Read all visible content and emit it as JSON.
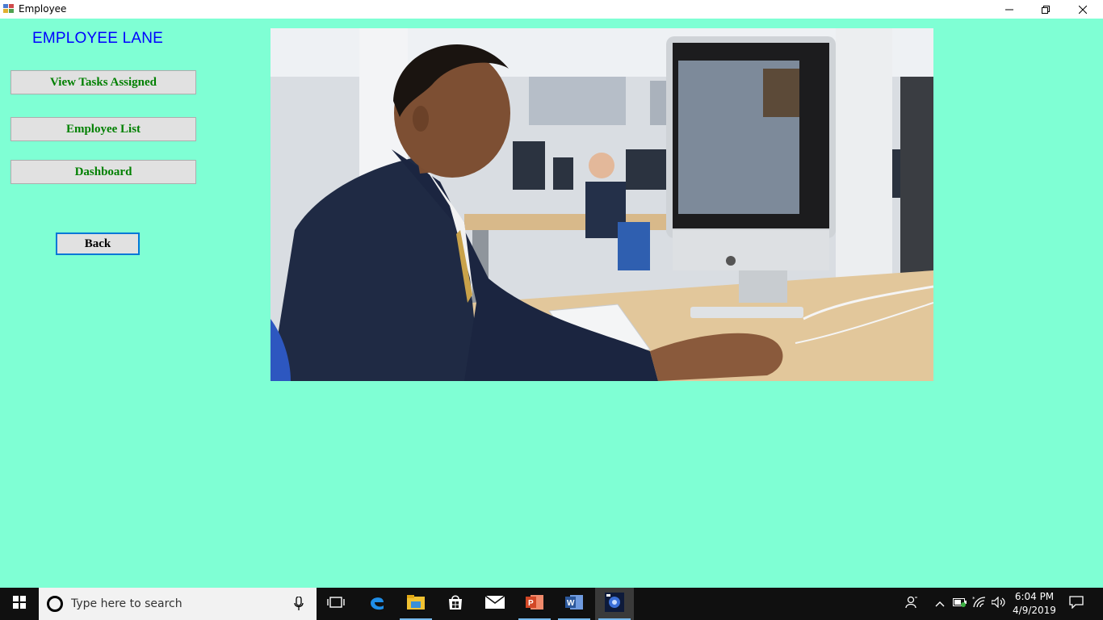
{
  "window": {
    "title": "Employee",
    "controls": {
      "minimize_icon": "minimize-icon",
      "restore_icon": "restore-icon",
      "close_icon": "close-icon"
    }
  },
  "sidebar": {
    "title": "EMPLOYEE LANE",
    "buttons": [
      {
        "label": "View Tasks Assigned"
      },
      {
        "label": "Employee List"
      },
      {
        "label": "Dashboard"
      }
    ],
    "back_label": "Back"
  },
  "main": {
    "image": {
      "icon": "photo-student-at-computer"
    }
  },
  "taskbar": {
    "search_placeholder": "Type here to search",
    "pinned": [
      "task-view-icon",
      "edge-icon",
      "file-explorer-icon",
      "store-icon",
      "mail-icon",
      "powerpoint-icon",
      "word-icon",
      "app-icon"
    ],
    "clock": {
      "time": "6:04 PM",
      "date": "4/9/2019"
    }
  },
  "colors": {
    "background": "#7fffd4",
    "title_blue": "#0000ff",
    "button_text_green": "#008000",
    "focus_blue": "#0078d7",
    "taskbar": "#101010"
  }
}
